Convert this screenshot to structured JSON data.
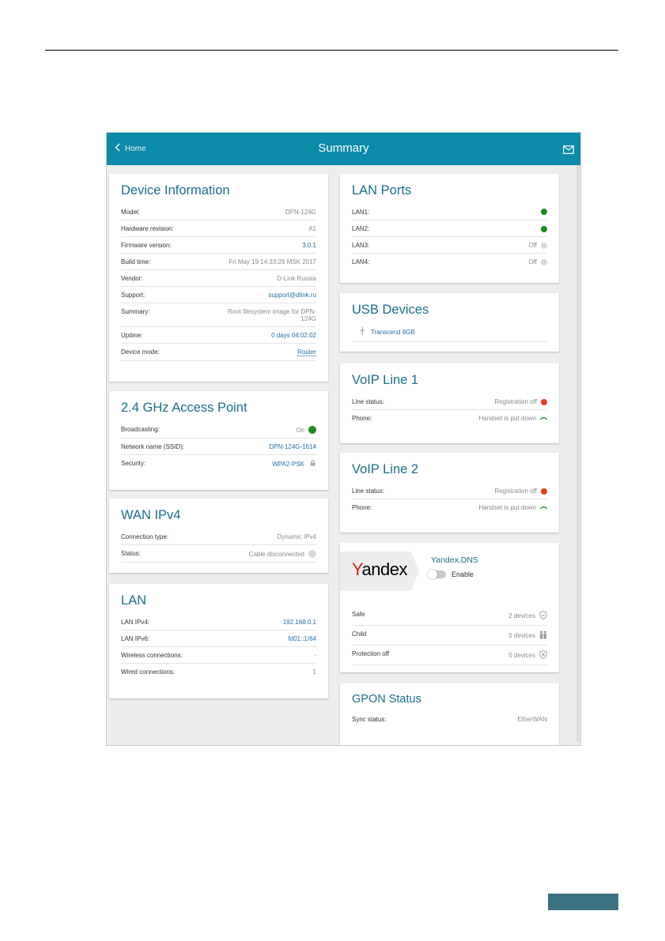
{
  "appbar": {
    "back_label": "Home",
    "title": "Summary"
  },
  "device_info": {
    "title": "Device Information",
    "rows": [
      {
        "k": "Model:",
        "v": "DPN-124G"
      },
      {
        "k": "Hardware revision:",
        "v": "A1"
      },
      {
        "k": "Firmware version:",
        "v": "3.0.1"
      },
      {
        "k": "Build time:",
        "v": "Fri May 19 14:33:26 MSK 2017"
      },
      {
        "k": "Vendor:",
        "v": "D-Link Russia"
      },
      {
        "k": "Support:",
        "v": "support@dlink.ru"
      },
      {
        "k": "Summary:",
        "v": "Root filesystem image for DPN-124G"
      },
      {
        "k": "Uptime:",
        "v": "0 days 04:02:02"
      },
      {
        "k": "Device mode:",
        "v": "Router"
      }
    ]
  },
  "access_point": {
    "title": "2.4 GHz Access Point",
    "rows": [
      {
        "k": "Broadcasting:",
        "v": "On"
      },
      {
        "k": "Network name (SSID):",
        "v": "DPN-124G-1614"
      },
      {
        "k": "Security:",
        "v": "WPA2-PSK"
      }
    ]
  },
  "wan": {
    "title": "WAN IPv4",
    "rows": [
      {
        "k": "Connection type:",
        "v": "Dynamic IPv4"
      },
      {
        "k": "Status:",
        "v": "Cable disconnected"
      }
    ]
  },
  "lan": {
    "title": "LAN",
    "rows": [
      {
        "k": "LAN IPv4:",
        "v": "192.168.0.1"
      },
      {
        "k": "LAN IPv6:",
        "v": "fd01::1/64"
      },
      {
        "k": "Wireless connections:",
        "v": "-"
      },
      {
        "k": "Wired connections:",
        "v": "1"
      }
    ]
  },
  "lan_ports": {
    "title": "LAN Ports",
    "rows": [
      {
        "k": "LAN1:",
        "v": "",
        "status": "#1e8a1e"
      },
      {
        "k": "LAN2:",
        "v": "↓",
        "status": "#1e8a1e"
      },
      {
        "k": "LAN3:",
        "v": "Off",
        "status": "#d8d8d8"
      },
      {
        "k": "LAN4:",
        "v": "Off",
        "status": "#d8d8d8"
      }
    ]
  },
  "usb": {
    "title": "USB Devices",
    "device": "Transcend 8GB",
    "icon": "usb-icon"
  },
  "voip1": {
    "title": "VoIP Line 1",
    "rows": [
      {
        "k": "Line status:",
        "v": "Registration off"
      },
      {
        "k": "Phone:",
        "v": "Handset is put down"
      }
    ]
  },
  "voip2": {
    "title": "VoIP Line 2",
    "rows": [
      {
        "k": "Line status:",
        "v": "Registration off"
      },
      {
        "k": "Phone:",
        "v": "Handset is put down"
      }
    ]
  },
  "yandex": {
    "logo": "Yandex",
    "name": "Yandex.DNS",
    "enable_label": "Enable",
    "enabled": false,
    "rows": [
      {
        "k": "Safe",
        "v": "2 devices",
        "icon": "shield-check-icon"
      },
      {
        "k": "Child",
        "v": "0 devices",
        "icon": "child-icon"
      },
      {
        "k": "Protection off",
        "v": "0 devices",
        "icon": "shield-off-icon"
      }
    ]
  },
  "gpon": {
    "title": "GPON Status",
    "rows": [
      {
        "k": "Sync status:",
        "v": "EtherWAN"
      }
    ]
  },
  "colors": {
    "header": "#0b8aaa",
    "title": "#1a6e8a",
    "link": "#1d6fa0",
    "green": "#1e8a1e",
    "red": "#e04020",
    "page_tab": "#3b7282"
  }
}
